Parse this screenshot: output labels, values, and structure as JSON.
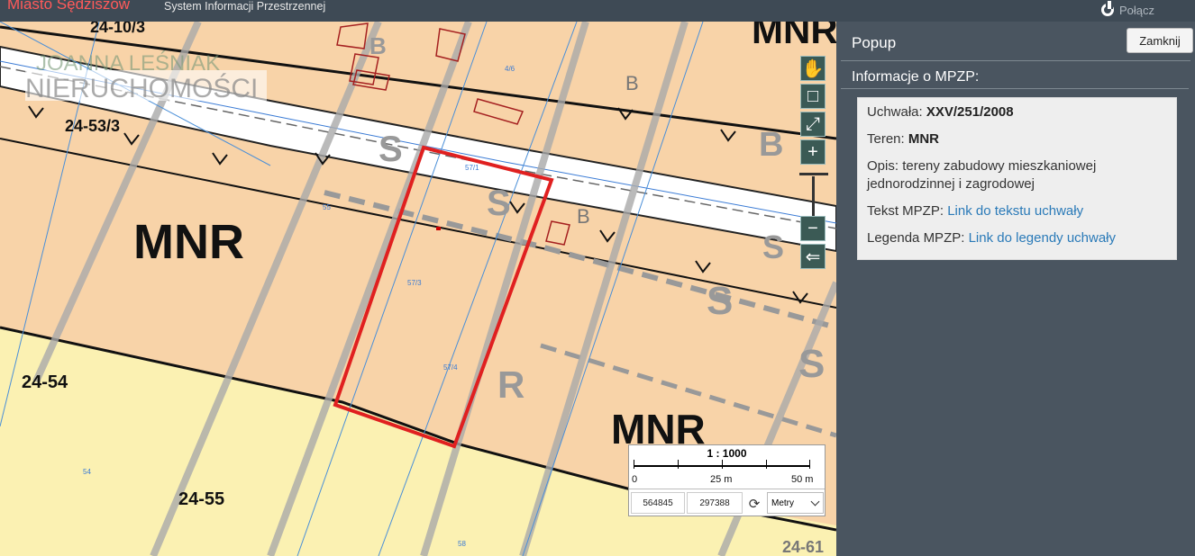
{
  "header": {
    "brand": "Miasto Sędziszów",
    "subtitle": "System Informacji Przestrzennej",
    "connect_label": "Połącz",
    "connect_icon": "power-icon"
  },
  "map": {
    "watermark_line1": "JOANNA LEŚNIAK",
    "watermark_line2": "NIERUCHOMOŚCI",
    "labels": {
      "mnr_left": "MNR",
      "mnr_right": "MNR",
      "mnr_top": "MNR",
      "lot_24_10_3": "24-10/3",
      "lot_24_53_3": "24-53/3",
      "lot_24_54": "24-54",
      "lot_24_55": "24-55",
      "lot_24_61": "24-61",
      "b1": "B",
      "b2": "B",
      "b3": "B",
      "b4": "B",
      "s1": "S",
      "s2": "S",
      "s3": "S",
      "s4": "S",
      "s5": "S",
      "r1": "R",
      "parcel_57_3": "57/3",
      "parcel_57_4": "57/4",
      "parcel_57_1": "57/1",
      "parcel_55": "55",
      "parcel_54": "54",
      "parcel_58": "58",
      "parcel_4_6": "4/6"
    },
    "tools": [
      {
        "name": "pan-hand-icon",
        "glyph": "✋"
      },
      {
        "name": "zoom-box-icon",
        "glyph": "□"
      },
      {
        "name": "full-extent-icon",
        "glyph": "⤢"
      },
      {
        "name": "zoom-in-icon",
        "glyph": "+"
      },
      {
        "name": "zoom-out-icon",
        "glyph": "−"
      },
      {
        "name": "back-arrow-icon",
        "glyph": "⇐"
      }
    ],
    "scale": {
      "ratio": "1 : 1000",
      "tick_0": "0",
      "tick_25": "25 m",
      "tick_50": "50 m"
    },
    "coords": {
      "x": "564845",
      "y": "297388",
      "units": "Metry"
    }
  },
  "popup": {
    "title": "Popup",
    "close_label": "Zamknij",
    "section_title": "Informacje o MPZP:",
    "rows": {
      "uchwala_label": "Uchwała: ",
      "uchwala_value": "XXV/251/2008",
      "teren_label": "Teren: ",
      "teren_value": "MNR",
      "opis_label": "Opis: ",
      "opis_value": "tereny zabudowy mieszkaniowej jednorodzinnej i zagrodowej",
      "tekst_label": "Tekst MPZP: ",
      "tekst_link": "Link do tekstu uchwały",
      "legenda_label": "Legenda MPZP: ",
      "legenda_link": "Link do legendy uchwały"
    }
  },
  "colors": {
    "map_zone_mnr": "#f8d3a8",
    "map_zone_r": "#fbf1b2",
    "highlight": "#e02020",
    "panel_bg": "#4a5560",
    "link": "#2a7ab8"
  }
}
